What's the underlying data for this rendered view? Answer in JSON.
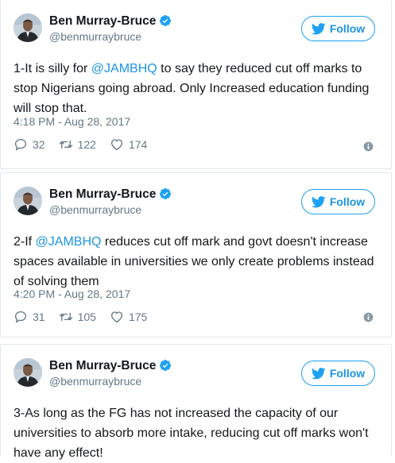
{
  "tweets": [
    {
      "name": "Ben Murray-Bruce",
      "handle": "@benmurraybruce",
      "follow_label": "Follow",
      "text_before": "1-It is silly for ",
      "mention": "@JAMBHQ",
      "text_after": " to say they reduced cut off marks to stop Nigerians going abroad. Only Increased education funding will stop that.",
      "timestamp": "4:18 PM - Aug 28, 2017",
      "replies": "32",
      "retweets": "122",
      "likes": "174"
    },
    {
      "name": "Ben Murray-Bruce",
      "handle": "@benmurraybruce",
      "follow_label": "Follow",
      "text_before": "2-If ",
      "mention": "@JAMBHQ",
      "text_after": " reduces cut off mark and govt doesn't increase spaces available in universities we only create problems instead of solving them",
      "timestamp": "4:20 PM - Aug 28, 2017",
      "replies": "31",
      "retweets": "105",
      "likes": "175"
    },
    {
      "name": "Ben Murray-Bruce",
      "handle": "@benmurraybruce",
      "follow_label": "Follow",
      "text": "3-As long as the FG has not increased the capacity of our universities to absorb more intake, reducing cut off marks won't have any effect!"
    }
  ],
  "colors": {
    "accent": "#1da1f2",
    "link": "#1b95e0",
    "muted": "#657786",
    "text": "#14171a",
    "border": "#e1e8ed"
  },
  "icons": [
    "twitter-bird-icon",
    "verified-badge-icon",
    "reply-icon",
    "retweet-icon",
    "like-heart-icon",
    "info-icon"
  ]
}
